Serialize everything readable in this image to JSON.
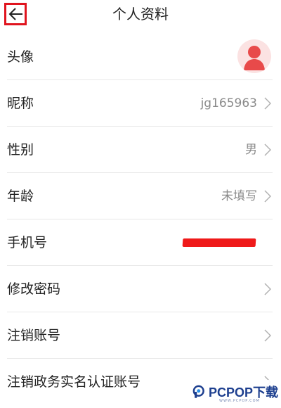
{
  "header": {
    "title": "个人资料",
    "back_icon": "arrow-left-icon"
  },
  "rows": [
    {
      "label": "头像",
      "value": "",
      "type": "avatar",
      "icon": "user-avatar-icon"
    },
    {
      "label": "昵称",
      "value": "jg165963",
      "type": "text"
    },
    {
      "label": "性别",
      "value": "男",
      "type": "text"
    },
    {
      "label": "年龄",
      "value": "未填写",
      "type": "text"
    },
    {
      "label": "手机号",
      "value": "",
      "type": "redacted"
    },
    {
      "label": "修改密码",
      "value": "",
      "type": "link"
    },
    {
      "label": "注销账号",
      "value": "",
      "type": "link"
    },
    {
      "label": "注销政务实名认证账号",
      "value": "",
      "type": "link"
    }
  ],
  "watermark": {
    "text": "PCPOP下载",
    "sub": "WWW.PCPOP.COM"
  },
  "colors": {
    "highlight_border": "#e0141e",
    "avatar_bg": "#fbe2e2",
    "avatar_fg": "#e84a4a",
    "redaction": "#ef1a1a",
    "watermark_blue": "#1d3f8f"
  }
}
